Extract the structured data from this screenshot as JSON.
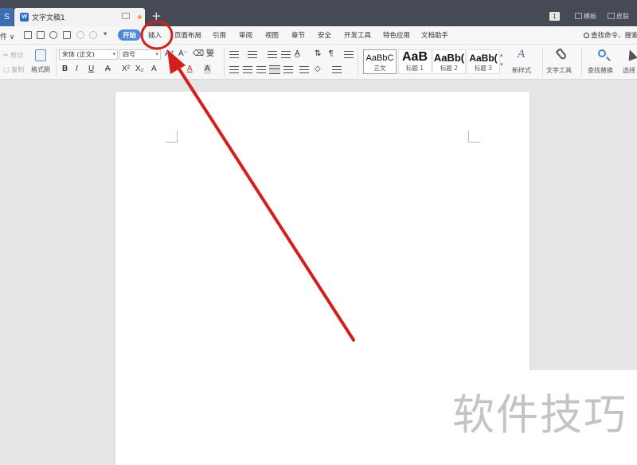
{
  "titlebar": {
    "app_label": "S",
    "doc_tab": {
      "title": "文字文稿1",
      "icon": "W"
    },
    "new_tab_symbol": "+",
    "page_count": "1",
    "template_label": "模板",
    "skin_label": "皮肤"
  },
  "menubar": {
    "file_fragment": "件",
    "file_arrow": "∨",
    "quick_dropdown": "▾",
    "items": [
      "开始",
      "插入",
      "页面布局",
      "引用",
      "审阅",
      "视图",
      "章节",
      "安全",
      "开发工具",
      "特色应用",
      "文档助手"
    ],
    "active_item": "开始",
    "find_command": "查找命令、搜索"
  },
  "ribbon": {
    "cut": "剪切",
    "copy": "复制",
    "format_painter": "格式刷",
    "font_name": "宋体 (正文)",
    "font_size": "四号",
    "styles": [
      {
        "sample": "AaBbC",
        "name": "正文"
      },
      {
        "sample": "AaB",
        "name": "标题 1"
      },
      {
        "sample": "AaBb(",
        "name": "标题 2"
      },
      {
        "sample": "AaBb(",
        "name": "标题 3"
      }
    ],
    "new_style": "新样式",
    "text_tools": "文字工具",
    "find_replace": "查找替换",
    "select": "选择"
  },
  "watermark": "软件技巧",
  "annotation_color": "#d41f1f",
  "accent_color": "#4d8bd9"
}
